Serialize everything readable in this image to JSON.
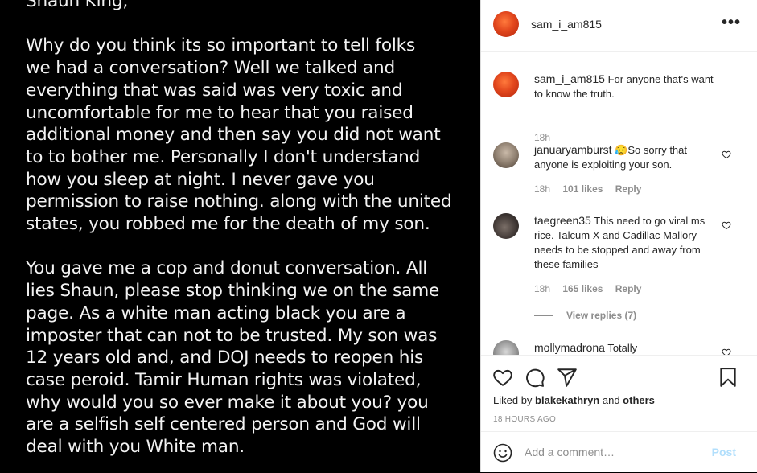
{
  "post_image": {
    "greeting": "Shaun King,",
    "paragraphs": [
      [
        "Why do you think its so important to tell folks",
        "we had a conversation? Well we talked and",
        "everything that was said was very toxic and",
        "uncomfortable for me to hear that you raised",
        "additional money and then say you did not want",
        "to to bother me. Personally I don't understand",
        "how you sleep at night. I never gave you",
        "permission to raise nothing. along with the united",
        "states, you robbed me for the death of my son."
      ],
      [
        "You gave me a cop and donut conversation. All",
        "lies Shaun, please stop thinking we on the same",
        "page. As a white man acting black you are  a",
        "imposter that can not to be trusted. My son was",
        "12 years old and, and DOJ needs to reopen his",
        "case peroid. Tamir Human rights was violated,",
        "why would you so ever make it about you? you",
        "are a selfish self centered person  and God will",
        "deal with you White man."
      ]
    ]
  },
  "header": {
    "username": "sam_i_am815",
    "more_icon": "more-icon",
    "more_glyph": "•••"
  },
  "comments": [
    {
      "username": "sam_i_am815",
      "text": "For anyone that's want to know the truth.",
      "time": "18h",
      "likes": "",
      "reply": ""
    },
    {
      "username": "januaryamburst",
      "emoji": "😥",
      "text": "So sorry that anyone is exploiting your son.",
      "time": "18h",
      "likes": "101 likes",
      "reply": "Reply"
    },
    {
      "username": "taegreen35",
      "text": "This need to go viral ms rice. Talcum X and Cadillac Mallory needs to be stopped and away from these families",
      "time": "18h",
      "likes": "165 likes",
      "reply": "Reply"
    },
    {
      "username": "mollymadrona",
      "text": "Totally",
      "time": "",
      "likes": "",
      "reply": ""
    }
  ],
  "view_replies": "View replies (7)",
  "actions": {
    "liked_by_prefix": "Liked by ",
    "liked_by_user": "blakekathryn",
    "liked_and": " and ",
    "liked_others": "others",
    "timestamp": "18 HOURS AGO"
  },
  "add_comment": {
    "placeholder": "Add a comment…",
    "post_label": "Post"
  },
  "colors": {
    "accent_link": "#b2dffc",
    "meta_gray": "#8e8e8e",
    "text": "#262626"
  }
}
